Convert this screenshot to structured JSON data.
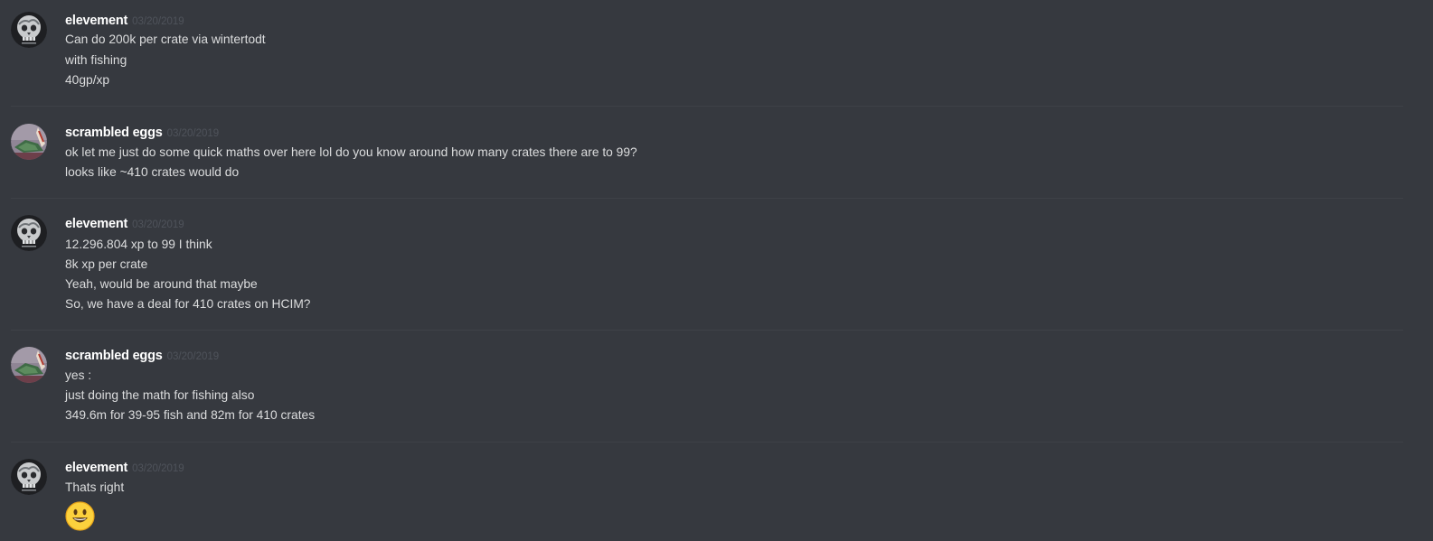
{
  "colors": {
    "background": "#36393f",
    "username": "#ffffff",
    "timestamp": "#4f535b",
    "message_text": "#dcddde",
    "divider": "#3e4147"
  },
  "messages": [
    {
      "username": "elevement",
      "timestamp": "03/20/2019",
      "avatar_icon": "skull-globe-avatar-icon",
      "lines": [
        "Can do 200k per crate via wintertodt",
        "with fishing",
        "40gp/xp"
      ]
    },
    {
      "username": "scrambled eggs",
      "timestamp": "03/20/2019",
      "avatar_icon": "landscape-avatar-icon",
      "lines": [
        "ok let me just do some quick maths over here lol do you know around how many crates there are to 99?",
        "looks like ~410 crates would do"
      ]
    },
    {
      "username": "elevement",
      "timestamp": "03/20/2019",
      "avatar_icon": "skull-globe-avatar-icon",
      "lines": [
        "12.296.804 xp to 99 I think",
        "8k xp per crate",
        "Yeah, would be around that maybe",
        "So, we have a deal for 410 crates on HCIM?"
      ]
    },
    {
      "username": "scrambled eggs",
      "timestamp": "03/20/2019",
      "avatar_icon": "landscape-avatar-icon",
      "lines": [
        "yes :",
        "just doing the math for fishing also",
        "349.6m for 39-95 fish and 82m for 410 crates"
      ]
    },
    {
      "username": "elevement",
      "timestamp": "03/20/2019",
      "avatar_icon": "skull-globe-avatar-icon",
      "lines": [
        "Thats right"
      ],
      "emoji": "smiley-emoji-icon"
    }
  ]
}
